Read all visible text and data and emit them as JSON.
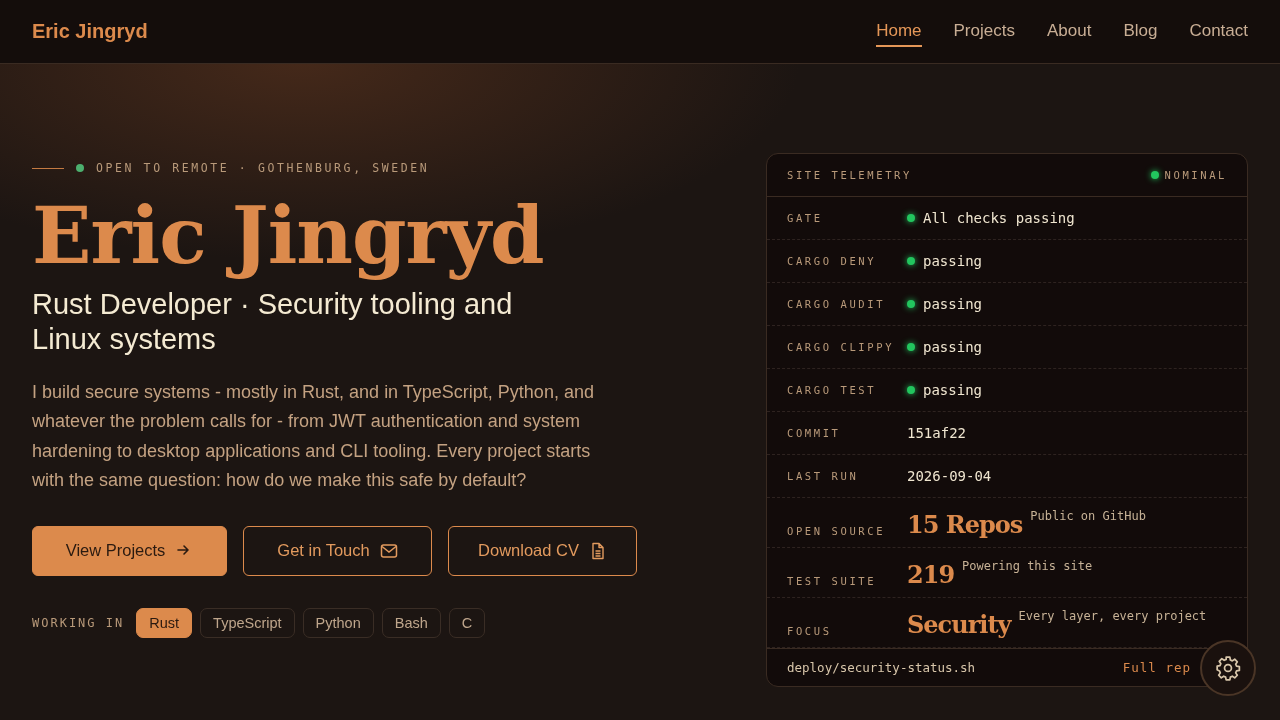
{
  "header": {
    "brand": "Eric Jingryd",
    "nav": [
      {
        "label": "Home",
        "selected": true
      },
      {
        "label": "Projects",
        "selected": false
      },
      {
        "label": "About",
        "selected": false
      },
      {
        "label": "Blog",
        "selected": false
      },
      {
        "label": "Contact",
        "selected": false
      }
    ]
  },
  "hero": {
    "status": {
      "text": "OPEN TO REMOTE · GOTHENBURG, SWEDEN",
      "color": "#4caf6e"
    },
    "name": "Eric Jingryd",
    "tagline": "Rust Developer · Security tooling and Linux systems",
    "intro": "I build secure systems - mostly in Rust, and in TypeScript, Python, and whatever the problem calls for - from JWT authentication and system hardening to desktop applications and CLI tooling. Every project starts with the same question: how do we make this safe by default?",
    "buttons": [
      {
        "label": "View Projects",
        "kind": "primary"
      },
      {
        "label": "Get in Touch",
        "kind": "outline"
      },
      {
        "label": "Download CV",
        "kind": "outline"
      }
    ],
    "stack_label": "WORKING IN",
    "stack": [
      {
        "label": "Rust",
        "selected": true
      },
      {
        "label": "TypeScript",
        "selected": false
      },
      {
        "label": "Python",
        "selected": false
      },
      {
        "label": "Bash",
        "selected": false
      },
      {
        "label": "C",
        "selected": false
      }
    ]
  },
  "telemetry": {
    "title": "SITE TELEMETRY",
    "status": {
      "text": "NOMINAL",
      "color": "#22c55e"
    },
    "rows": [
      {
        "kind": "status",
        "label": "GATE",
        "value": "All checks passing",
        "color": "#22c55e"
      },
      {
        "kind": "status",
        "label": "CARGO DENY",
        "value": "passing",
        "color": "#22c55e"
      },
      {
        "kind": "status",
        "label": "CARGO AUDIT",
        "value": "passing",
        "color": "#22c55e"
      },
      {
        "kind": "status",
        "label": "CARGO CLIPPY",
        "value": "passing",
        "color": "#22c55e"
      },
      {
        "kind": "status",
        "label": "CARGO TEST",
        "value": "passing",
        "color": "#22c55e"
      },
      {
        "kind": "value",
        "label": "COMMIT",
        "value": "151af22"
      },
      {
        "kind": "value",
        "label": "LAST RUN",
        "value": "2026-09-04"
      },
      {
        "kind": "stat",
        "label": "OPEN SOURCE",
        "value": "15 Repos",
        "caption": "Public on GitHub"
      },
      {
        "kind": "stat",
        "label": "TEST SUITE",
        "value": "219",
        "caption": "Powering this site"
      },
      {
        "kind": "stat",
        "label": "FOCUS",
        "value": "Security",
        "caption": "Every layer, every project"
      }
    ],
    "footer_path": "deploy/security-status.sh",
    "footer_link": "Full rep"
  }
}
